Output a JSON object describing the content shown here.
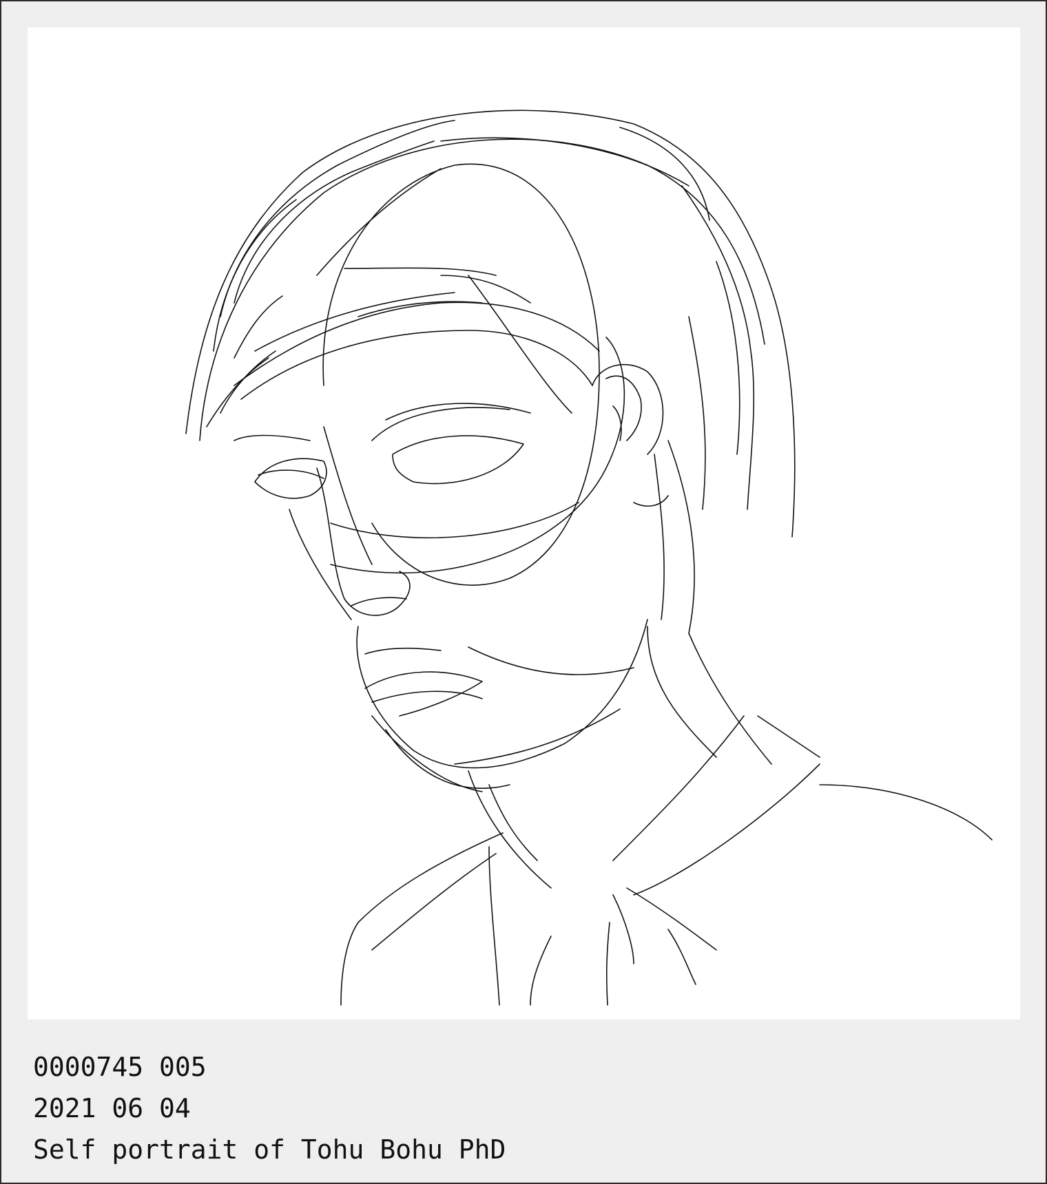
{
  "caption": {
    "line1": "0000745 005",
    "line2": "2021 06 04",
    "line3": "Self portrait of Tohu Bohu PhD"
  },
  "colors": {
    "frame_bg": "#efefef",
    "canvas_bg": "#ffffff",
    "ink": "#111111"
  }
}
